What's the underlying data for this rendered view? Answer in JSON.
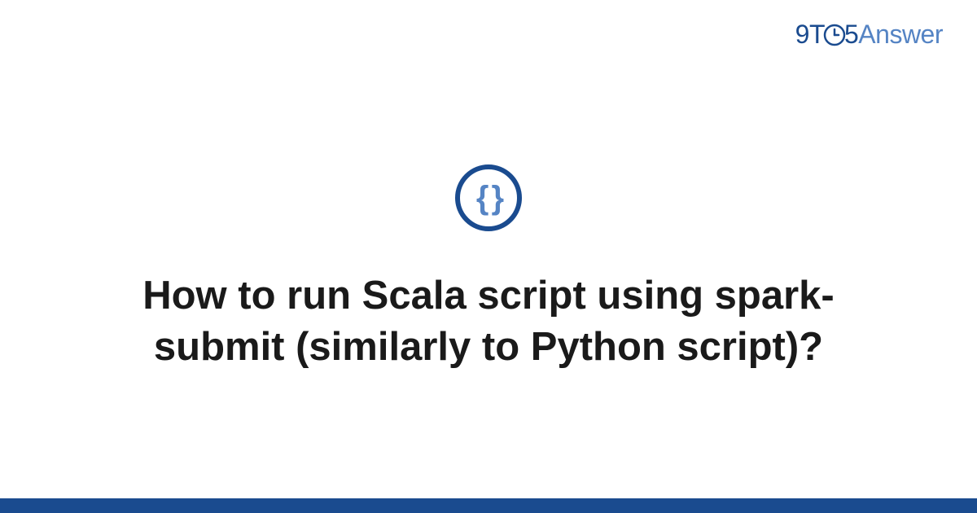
{
  "logo": {
    "part1": "9T",
    "part2": "5",
    "part3": "Answer"
  },
  "icon": {
    "braces": "{ }",
    "semantic": "code-braces-icon"
  },
  "title": "How to run Scala script using spark-submit (similarly to Python script)?",
  "colors": {
    "primary": "#1a4b8f",
    "secondary": "#5584c4",
    "text": "#1a1a1a",
    "background": "#ffffff"
  }
}
